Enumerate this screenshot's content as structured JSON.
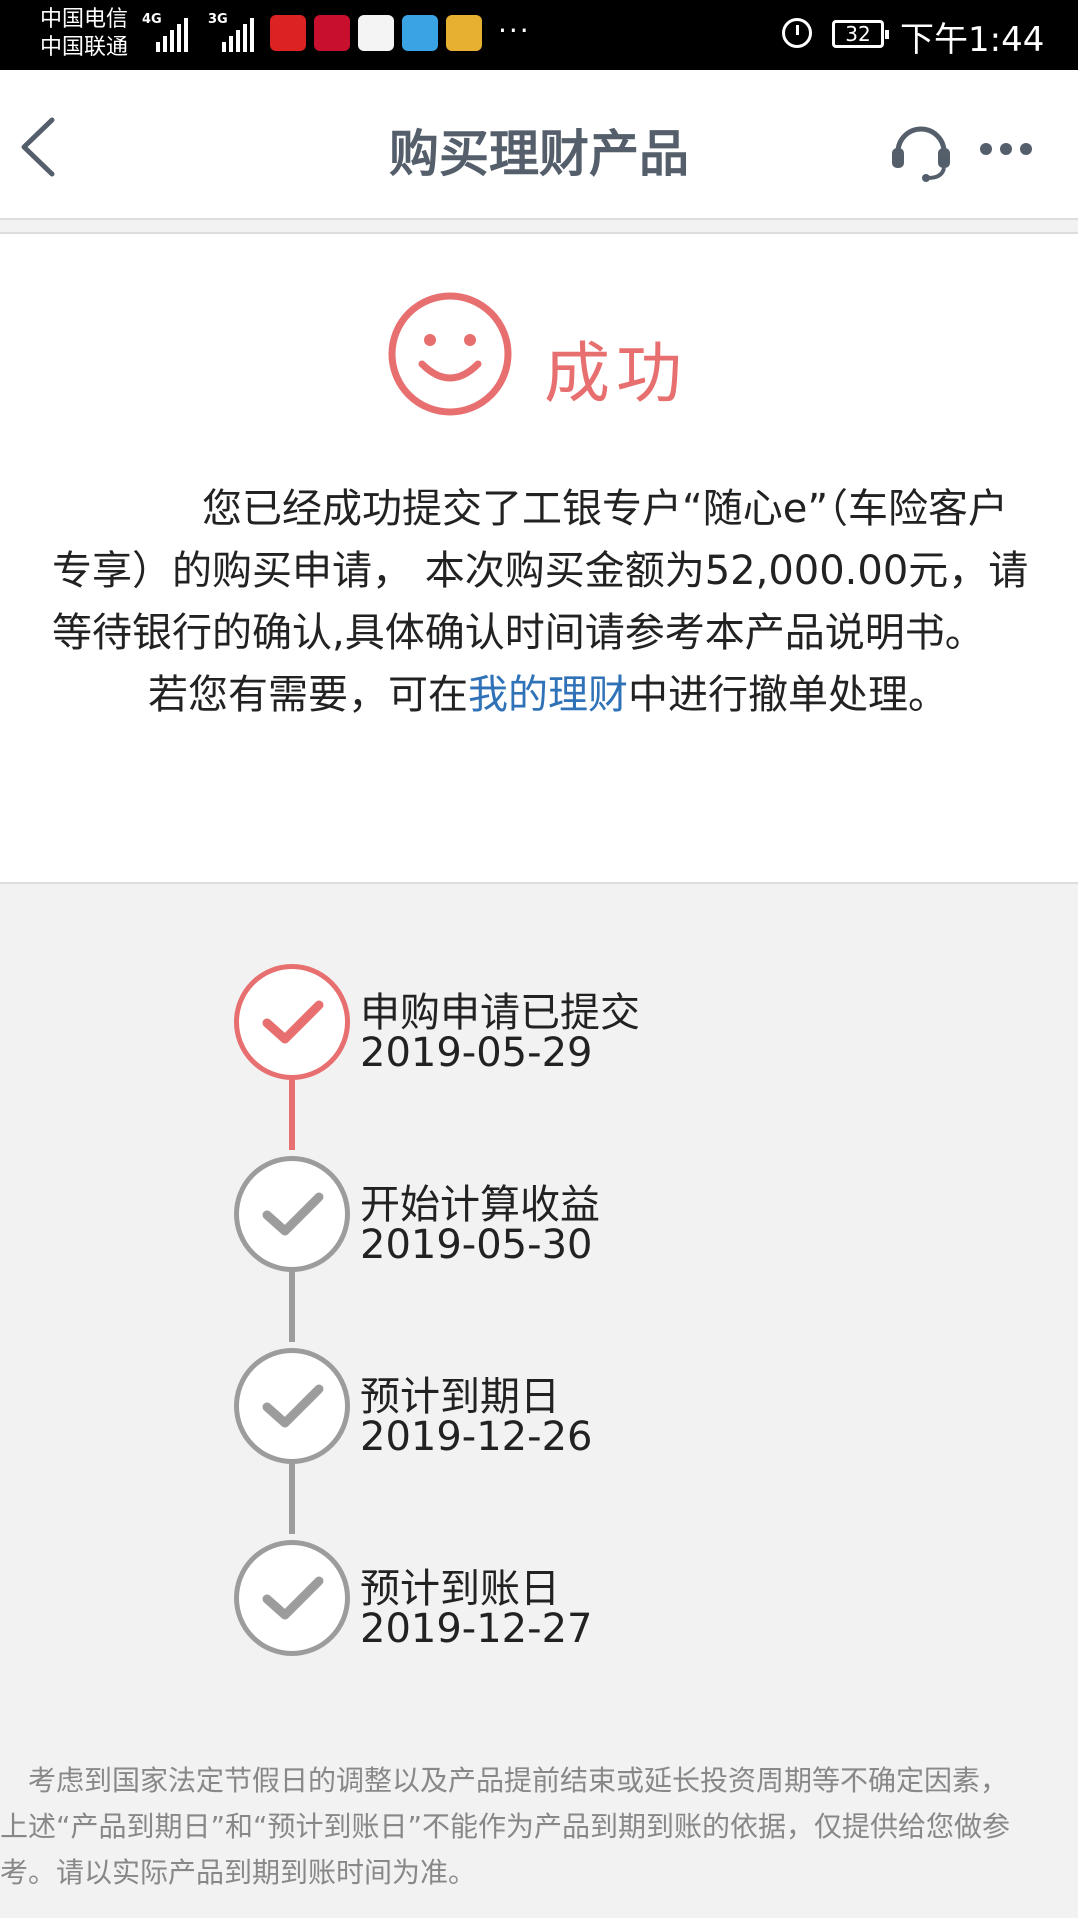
{
  "status_bar": {
    "carrier1": "中国电信",
    "carrier2": "中国联通",
    "net1": "4G",
    "net2": "3G",
    "more": "···",
    "battery": "32",
    "time": "下午1:44"
  },
  "header": {
    "title": "购买理财产品",
    "back_icon": "chevron-left-icon",
    "service_icon": "headset-icon",
    "more_icon": "more-dots-icon"
  },
  "result": {
    "status": "成功",
    "message_line1": "您已经成功提交了工银专户“随心e”（车险客户专享）的购买申请， 本次购买金额为52,000.00元，请等待银行的确认,具体确认时间请参考本产品说明书。",
    "message_prefix2": "若您有需要，可在",
    "link_text": "我的理财",
    "message_suffix2": "中进行撤单处理。"
  },
  "timeline": [
    {
      "title": "申购申请已提交",
      "date": "2019-05-29",
      "active": true
    },
    {
      "title": "开始计算收益",
      "date": "2019-05-30",
      "active": false
    },
    {
      "title": "预计到期日",
      "date": "2019-12-26",
      "active": false
    },
    {
      "title": "预计到账日",
      "date": "2019-12-27",
      "active": false
    }
  ],
  "disclaimer": {
    "line1": "考虑到国家法定节假日的调整以及产品提前结束或延长投资周期等不确定因素，",
    "line2": "上述“产品到期日”和“预计到账日”不能作为产品到期到账的依据，仅提供给您做参",
    "line3": "考。请以实际产品到期到账时间为准。"
  },
  "colors": {
    "accent_red": "#e86f6f",
    "link_blue": "#2f72b7",
    "title_gray": "#555f6b",
    "inactive_gray": "#9c9c9c"
  }
}
